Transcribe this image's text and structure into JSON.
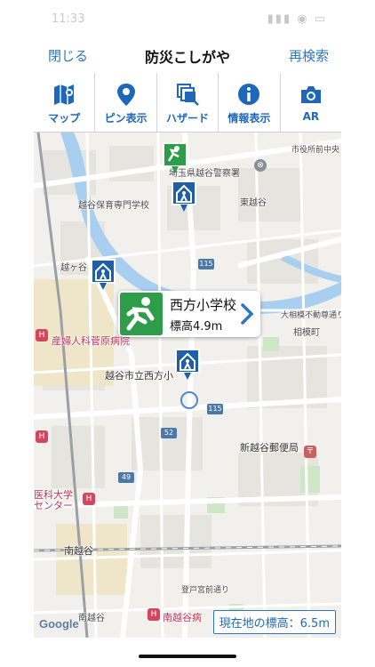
{
  "status_bar": {
    "time": "11:33",
    "indicators": "▮▮▮ ◉ ▭"
  },
  "nav": {
    "close_label": "閉じる",
    "title": "防災こしがや",
    "research_label": "再検索"
  },
  "toolbar": [
    {
      "icon": "map-icon",
      "label": "マップ"
    },
    {
      "icon": "pin-icon",
      "label": "ピン表示"
    },
    {
      "icon": "hazard-icon",
      "label": "ハザード"
    },
    {
      "icon": "info-icon",
      "label": "情報表示"
    },
    {
      "icon": "camera-icon",
      "label": "AR"
    }
  ],
  "map": {
    "labels": {
      "police": "埼玉県越谷警察署",
      "cityhall_road": "市役所前中央",
      "nursery_school": "越谷保育専門学校",
      "higashikoshigaya": "東越谷",
      "koshigaya_town": "越ヶ谷",
      "daisen_road": "大相模不動尊通り",
      "aiohara": "相模町",
      "hospital": "産婦人科菅原病院",
      "school_label": "越谷市立西方小",
      "post_office": "新越谷郵便局",
      "medical_center": "医科大学 センター",
      "minami_station": "南越谷",
      "tobe_road": "登戸宮前通り",
      "minami_koshigaya": "南越谷",
      "minami_hospital": "南越谷病"
    },
    "routes": {
      "r1": "115",
      "r2": "115",
      "r3": "52",
      "r4": "49"
    },
    "callout": {
      "name": "西方小学校",
      "elevation": "標高4.9m"
    },
    "google": "Google",
    "current_elevation": "現在地の標高：6.5m"
  },
  "colors": {
    "accent": "#2f74c0",
    "exit_green": "#2e9d49",
    "shelter_blue": "#1f5fa8"
  }
}
